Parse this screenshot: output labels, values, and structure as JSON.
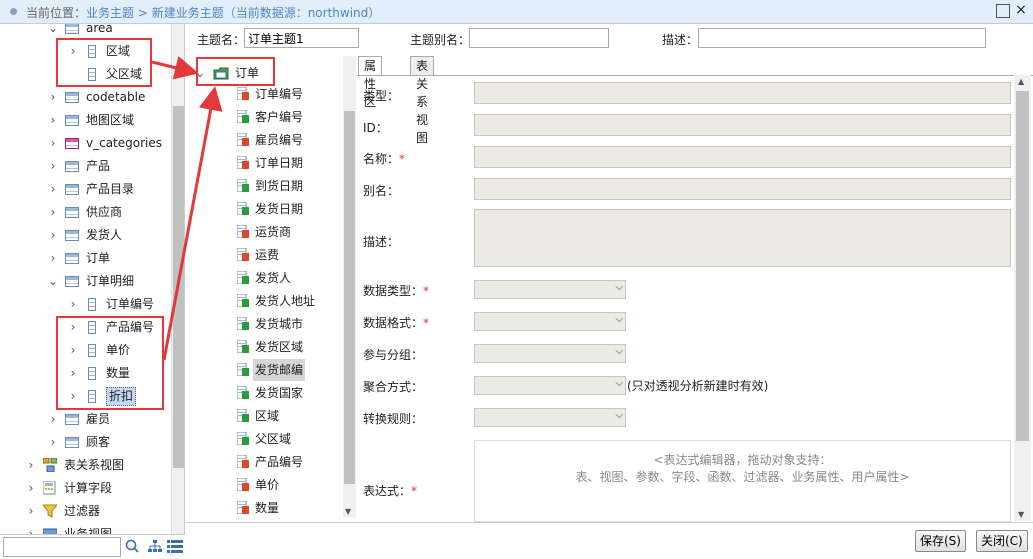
{
  "breadcrumb": {
    "prefix": "当前位置：",
    "text": "业务主题 > 新建业务主题（当前数据源：northwind）"
  },
  "window": {
    "max_label": "□",
    "close_label": "×"
  },
  "left_tree": {
    "items": [
      {
        "label": "area",
        "chev": "⌄",
        "icon": "table-icon"
      },
      {
        "label": "区域",
        "chev": "›",
        "icon": "field-icon"
      },
      {
        "label": "父区域",
        "chev": "",
        "icon": "field-icon"
      },
      {
        "label": "codetable",
        "chev": "›",
        "icon": "table-icon"
      },
      {
        "label": "地图区域",
        "chev": "›",
        "icon": "table-icon"
      },
      {
        "label": "v_categories",
        "chev": "›",
        "icon": "view-icon"
      },
      {
        "label": "产品",
        "chev": "›",
        "icon": "table-icon"
      },
      {
        "label": "产品目录",
        "chev": "›",
        "icon": "table-icon"
      },
      {
        "label": "供应商",
        "chev": "›",
        "icon": "table-icon"
      },
      {
        "label": "发货人",
        "chev": "›",
        "icon": "table-icon"
      },
      {
        "label": "订单",
        "chev": "›",
        "icon": "table-icon"
      },
      {
        "label": "订单明细",
        "chev": "⌄",
        "icon": "table-icon"
      },
      {
        "label": "订单编号",
        "chev": "›",
        "icon": "field-icon"
      },
      {
        "label": "产品编号",
        "chev": "›",
        "icon": "field-icon"
      },
      {
        "label": "单价",
        "chev": "›",
        "icon": "field-icon"
      },
      {
        "label": "数量",
        "chev": "›",
        "icon": "field-icon"
      },
      {
        "label": "折扣",
        "chev": "›",
        "icon": "field-icon"
      },
      {
        "label": "雇员",
        "chev": "›",
        "icon": "table-icon"
      },
      {
        "label": "顾客",
        "chev": "›",
        "icon": "table-icon"
      },
      {
        "label": "表关系视图",
        "chev": "›",
        "icon": "relation-view-icon"
      },
      {
        "label": "计算字段",
        "chev": "›",
        "icon": "calc-field-icon"
      },
      {
        "label": "过滤器",
        "chev": "›",
        "icon": "filter-icon"
      },
      {
        "label": "业务视图",
        "chev": "›",
        "icon": "business-view-icon"
      }
    ]
  },
  "form": {
    "topic_name_label": "主题名：",
    "topic_name_value": "订单主题1",
    "alias_label": "主题别名：",
    "alias_value": "",
    "desc_label": "描述：",
    "desc_value": ""
  },
  "mid_tree": {
    "root": "订单",
    "root_chev": "⌄",
    "fields": [
      {
        "label": "订单编号",
        "color": "#d94a2a"
      },
      {
        "label": "客户编号",
        "color": "#2e9a3e"
      },
      {
        "label": "雇员编号",
        "color": "#d94a2a"
      },
      {
        "label": "订单日期",
        "color": "#d94a2a"
      },
      {
        "label": "到货日期",
        "color": "#2e9a3e"
      },
      {
        "label": "发货日期",
        "color": "#2e9a3e"
      },
      {
        "label": "运货商",
        "color": "#d94a2a"
      },
      {
        "label": "运费",
        "color": "#d94a2a"
      },
      {
        "label": "发货人",
        "color": "#2e9a3e"
      },
      {
        "label": "发货人地址",
        "color": "#2e9a3e"
      },
      {
        "label": "发货城市",
        "color": "#2e9a3e"
      },
      {
        "label": "发货区域",
        "color": "#2e9a3e"
      },
      {
        "label": "发货邮编",
        "color": "#2e9a3e"
      },
      {
        "label": "发货国家",
        "color": "#2e9a3e"
      },
      {
        "label": "区域",
        "color": "#2e9a3e"
      },
      {
        "label": "父区域",
        "color": "#2e9a3e"
      },
      {
        "label": "产品编号",
        "color": "#d94a2a"
      },
      {
        "label": "单价",
        "color": "#d94a2a"
      },
      {
        "label": "数量",
        "color": "#d94a2a"
      }
    ],
    "selected_field": "发货邮编"
  },
  "tabs": {
    "properties": "属性区",
    "relation_view": "表关系视图"
  },
  "props": {
    "type": "类型：",
    "id": "ID：",
    "name": "名称：",
    "alias": "别名：",
    "description": "描述：",
    "data_type": "数据类型：",
    "data_format": "数据格式：",
    "group": "参与分组：",
    "aggregate": "聚合方式：",
    "aggregate_hint": "(只对透视分析新建时有效)",
    "convert": "转换规则：",
    "expression": "表达式：",
    "required_mark": "*"
  },
  "expression_editor": {
    "hint_line1": "<表达式编辑器，拖动对象支持：",
    "hint_line2": "表、视图、参数、字段、函数、过滤器、业务属性、用户属性>"
  },
  "buttons": {
    "save": "保存(S)",
    "close": "关闭(C)"
  },
  "accent_color": "#4a86c7",
  "annotation_color": "#e5383b"
}
